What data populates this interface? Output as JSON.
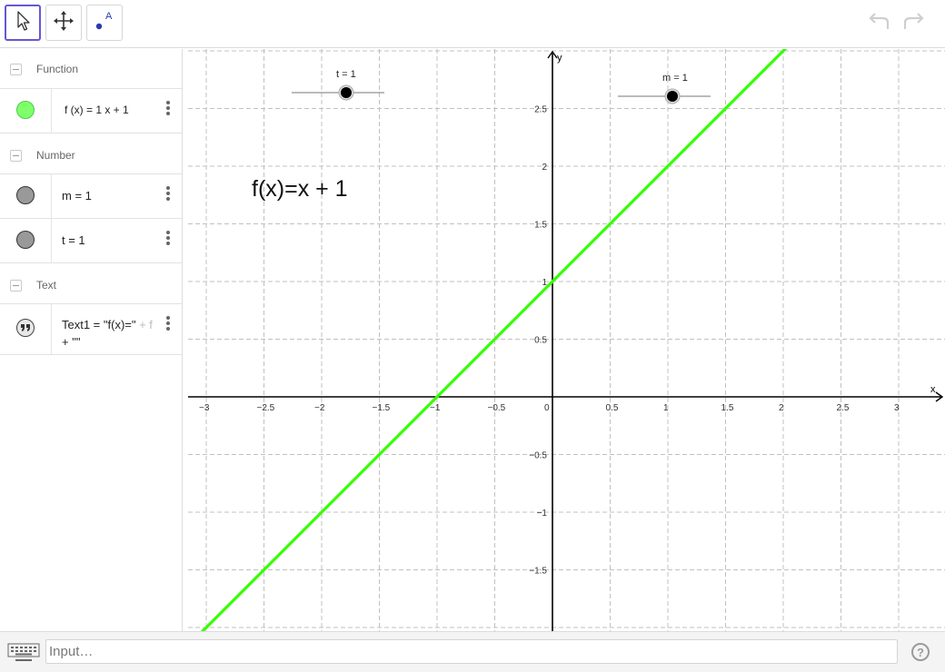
{
  "toolbar": {
    "tools": [
      {
        "name": "Move",
        "icon": "arrow-cursor-icon",
        "active": true
      },
      {
        "name": "Move Graphics View",
        "icon": "move-cross-icon",
        "active": false
      },
      {
        "name": "Point",
        "icon": "point-A-icon",
        "label": "A",
        "active": false
      }
    ],
    "undo_icon": "undo-icon",
    "redo_icon": "redo-icon"
  },
  "algebra": {
    "groups": [
      {
        "label": "Function",
        "items": [
          {
            "text": "f (x)  =  1 x + 1",
            "color": "#7fff6a",
            "marble_border": "#4ccd4c"
          }
        ]
      },
      {
        "label": "Number",
        "items": [
          {
            "text": "m = 1",
            "color": "#999999",
            "marble_border": "#333333"
          },
          {
            "text": "t = 1",
            "color": "#999999",
            "marble_border": "#333333"
          }
        ]
      },
      {
        "label": "Text",
        "items": [
          {
            "line1": "Text1 = \"f(x)=\"",
            "line1_faded": " + f",
            "line2": "+ \"\"",
            "icon": "quote-icon"
          }
        ]
      }
    ]
  },
  "graphics": {
    "text_object": "f(x)=x + 1",
    "sliders": [
      {
        "label": "t = 1",
        "value": 1
      },
      {
        "label": "m = 1",
        "value": 1
      }
    ],
    "function_color": "#33ff00",
    "axis_labels": {
      "x": "x",
      "y": "y"
    },
    "x_ticks": [
      "−3",
      "−2.5",
      "−2",
      "−1.5",
      "−1",
      "−0.5",
      "0",
      "0.5",
      "1",
      "1.5",
      "2",
      "2.5",
      "3"
    ],
    "y_ticks": [
      "2.5",
      "2",
      "1.5",
      "1",
      "0.5",
      "−0.5",
      "−1",
      "−1.5"
    ],
    "function": {
      "slope": 1,
      "intercept": 1
    }
  },
  "input": {
    "placeholder": "Input…",
    "keyboard_icon": "keyboard-icon",
    "help_icon": "help-icon",
    "help_label": "?"
  }
}
